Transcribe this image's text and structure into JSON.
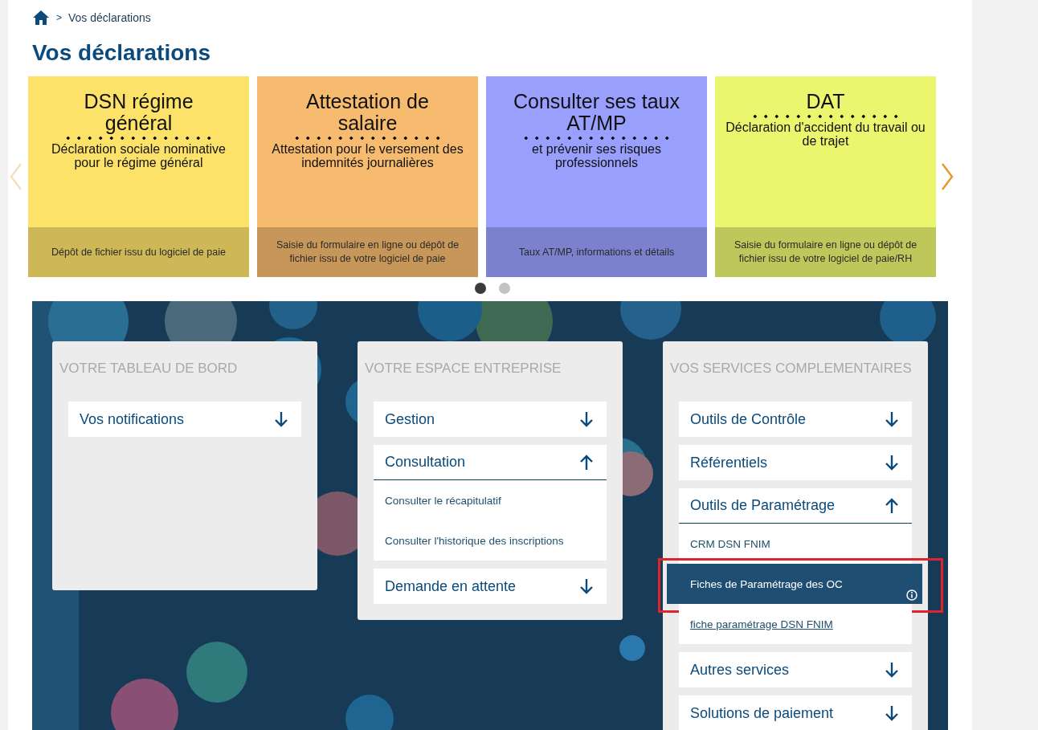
{
  "breadcrumb": {
    "separator": ">",
    "current": "Vos déclarations"
  },
  "page_title": "Vos déclarations",
  "carousel": {
    "prev": {
      "disabled": true
    },
    "next": {
      "disabled": false
    },
    "tiles": [
      {
        "title": "DSN régime général",
        "subtitle": "Déclaration sociale nominative pour le régime général",
        "footer": "Dépôt de fichier issu du logiciel de paie",
        "color": "#fde26a"
      },
      {
        "title": "Attestation de salaire",
        "subtitle": "Attestation pour le versement des indemnités journalières",
        "footer": "Saisie du formulaire en ligne ou dépôt de fichier issu de votre logiciel de paie",
        "color": "#f6bb6f"
      },
      {
        "title": "Consulter ses taux AT/MP",
        "subtitle": "et prévenir ses risques professionnels",
        "footer": "Taux AT/MP, informations et détails",
        "color": "#989ffd"
      },
      {
        "title": "DAT",
        "subtitle": "Déclaration d'accident du travail ou de trajet",
        "footer": "Saisie du formulaire en ligne ou dépôt de fichier issu de votre logiciel de paie/RH",
        "color": "#ebf56e"
      }
    ],
    "dots": [
      {
        "selected": true
      },
      {
        "selected": false
      }
    ]
  },
  "panels": [
    {
      "title": "VOTRE TABLEAU DE BORD",
      "items": [
        {
          "label": "Vos notifications",
          "expanded": false
        }
      ]
    },
    {
      "title": "VOTRE ESPACE ENTREPRISE",
      "items": [
        {
          "label": "Gestion",
          "expanded": false
        },
        {
          "label": "Consultation",
          "expanded": true,
          "children": [
            {
              "label": "Consulter le récapitulatif",
              "kind": "text",
              "selected": false,
              "annotated": false
            },
            {
              "label": "Consulter l'historique des inscriptions",
              "kind": "text",
              "selected": false,
              "annotated": false
            }
          ]
        },
        {
          "label": "Demande en attente",
          "expanded": false
        }
      ]
    },
    {
      "title": "VOS SERVICES COMPLEMENTAIRES",
      "items": [
        {
          "label": "Outils de Contrôle",
          "expanded": false
        },
        {
          "label": "Référentiels",
          "expanded": false
        },
        {
          "label": "Outils de Paramétrage",
          "expanded": true,
          "children": [
            {
              "label": "CRM DSN FNIM",
              "kind": "text",
              "selected": false,
              "annotated": false
            },
            {
              "label": "Fiches de Paramétrage des OC",
              "kind": "text",
              "selected": true,
              "annotated": true
            },
            {
              "label": "fiche paramétrage DSN FNIM",
              "kind": "link",
              "selected": false,
              "annotated": false
            }
          ]
        },
        {
          "label": "Autres services",
          "expanded": false
        },
        {
          "label": "Solutions de paiement",
          "expanded": false
        }
      ]
    }
  ]
}
